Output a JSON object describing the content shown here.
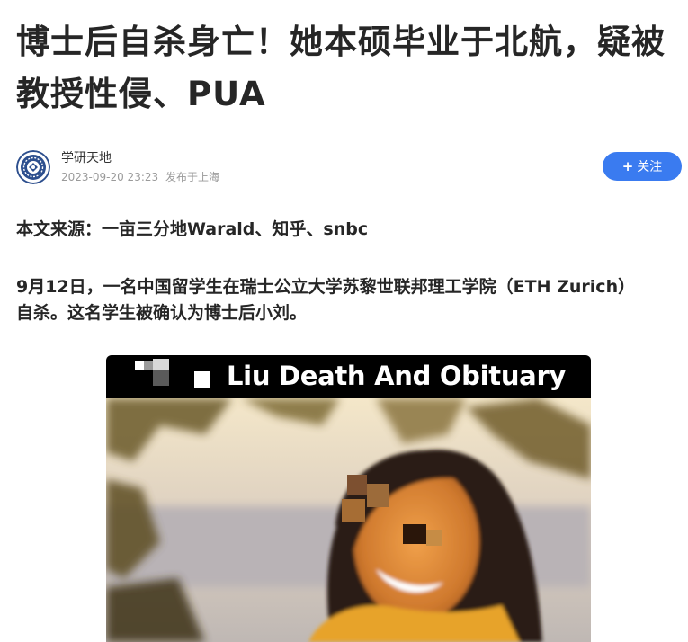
{
  "article": {
    "title": "博士后自杀身亡！她本硕毕业于北航，疑被教授性侵、PUA"
  },
  "author": {
    "name": "学研天地",
    "date": "2023-09-20 23:23",
    "location": "发布于上海",
    "avatar_icon": "institution-seal-icon",
    "follow_label": "关注",
    "follow_icon": "plus-icon"
  },
  "body": {
    "source": "本文来源：一亩三分地Warald、知乎、snbc",
    "paragraph": "9月12日，一名中国留学生在瑞士公立大学苏黎世联邦理工学院（ETH Zurich）自杀。这名学生被确认为博士后小刘。"
  },
  "image": {
    "caption": "Liu Death And Obituary"
  },
  "colors": {
    "accent": "#3a7bf0",
    "title_text": "#262626",
    "meta_text": "#9a9a9a"
  }
}
